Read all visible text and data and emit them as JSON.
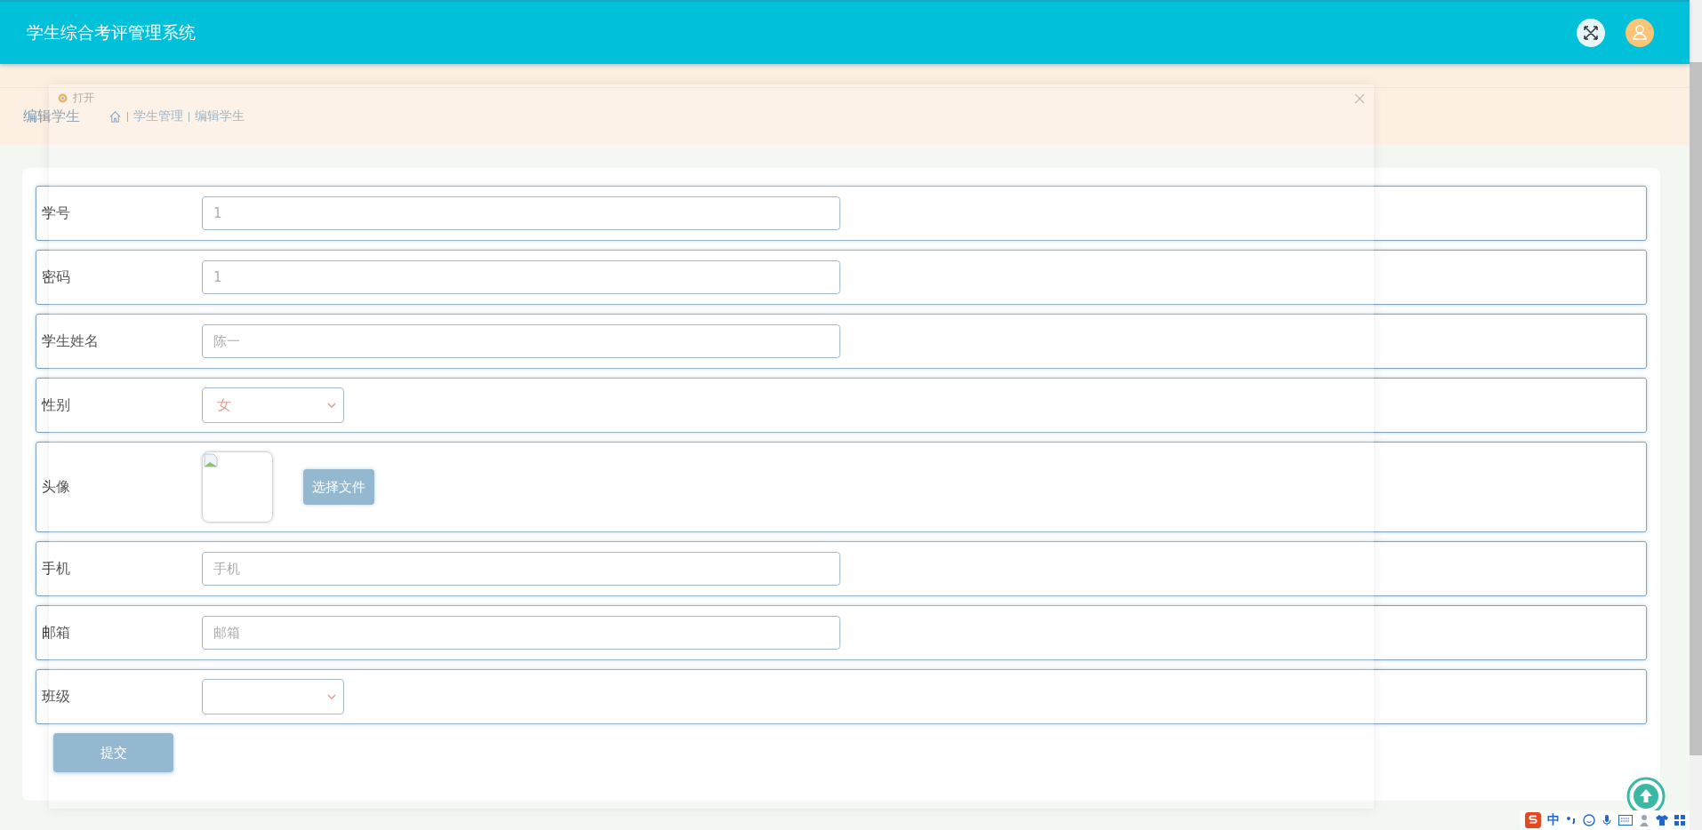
{
  "header": {
    "title": "学生综合考评管理系统"
  },
  "page_title": "编辑学生",
  "breadcrumb": [
    "学生管理",
    "编辑学生"
  ],
  "form": {
    "fields": [
      {
        "label": "学号",
        "kind": "text",
        "value": "1"
      },
      {
        "label": "密码",
        "kind": "text",
        "value": "1"
      },
      {
        "label": "学生姓名",
        "kind": "text",
        "value": "陈一"
      },
      {
        "label": "性别",
        "kind": "select",
        "value": "女"
      },
      {
        "label": "头像",
        "kind": "image",
        "button": "选择文件"
      },
      {
        "label": "手机",
        "kind": "text",
        "placeholder": "手机"
      },
      {
        "label": "邮箱",
        "kind": "text",
        "placeholder": "邮箱"
      },
      {
        "label": "班级",
        "kind": "select"
      }
    ],
    "submit": "提交"
  },
  "dialog": {
    "title": "打开"
  },
  "ime_bar": {
    "mode": "中"
  }
}
